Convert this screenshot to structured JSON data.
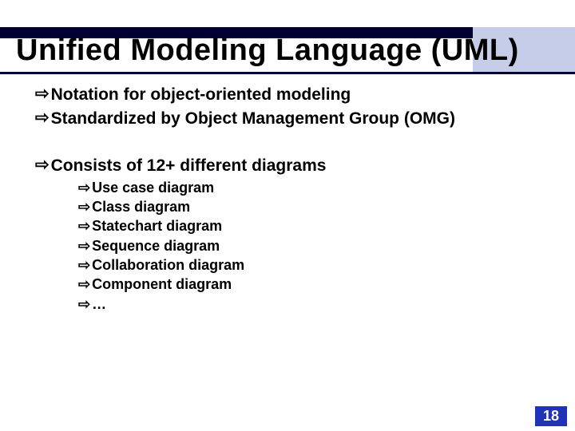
{
  "title": "Unified Modeling Language (UML)",
  "arrow_glyph": "⇨",
  "points": {
    "p1": "Notation for object-oriented modeling",
    "p2": "Standardized by Object Management Group (OMG)",
    "p3": "Consists of 12+ different diagrams"
  },
  "sub": {
    "s1": "Use case diagram",
    "s2": "Class diagram",
    "s3": "Statechart diagram",
    "s4": "Sequence diagram",
    "s5": "Collaboration diagram",
    "s6": "Component diagram",
    "s7": "…"
  },
  "page_number": "18"
}
